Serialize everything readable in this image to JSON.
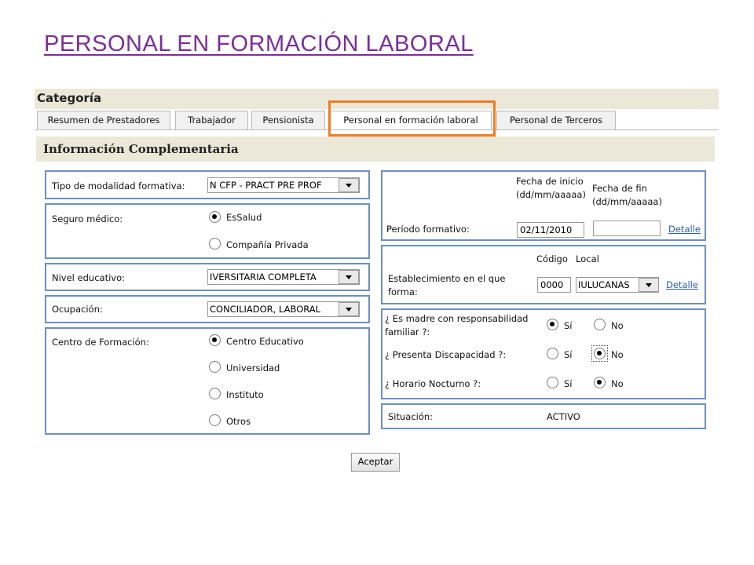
{
  "page_title": "PERSONAL EN FORMACIÓN LABORAL",
  "category": {
    "title": "Categoría",
    "tabs": [
      {
        "label": "Resumen de Prestadores"
      },
      {
        "label": "Trabajador"
      },
      {
        "label": "Pensionista"
      },
      {
        "label": "Personal en formación laboral",
        "active": true
      },
      {
        "label": "Personal de Terceros"
      }
    ]
  },
  "section_title": "Información Complementaria",
  "left": {
    "modalidad": {
      "label": "Tipo de modalidad formativa:",
      "value": "N CFP - PRACT PRE PROF"
    },
    "seguro": {
      "label": "Seguro médico:",
      "options": [
        "EsSalud",
        "Compañía Privada"
      ],
      "selected": "EsSalud"
    },
    "nivel": {
      "label": "Nivel educativo:",
      "value": "IVERSITARIA COMPLETA"
    },
    "ocupacion": {
      "label": "Ocupación:",
      "value": "CONCILIADOR, LABORAL"
    },
    "centro": {
      "label": "Centro de Formación:",
      "options": [
        "Centro Educativo",
        "Universidad",
        "Instituto",
        "Otros"
      ],
      "selected": "Centro Educativo"
    }
  },
  "right": {
    "periodo": {
      "label": "Período formativo:",
      "inicio_header": "Fecha de inicio (dd/mm/aaaaa)",
      "fin_header": "Fecha de fin (dd/mm/aaaaa)",
      "inicio_value": "02/11/2010",
      "fin_value": "",
      "detalle": "Detalle"
    },
    "establecimiento": {
      "label": "Establecimiento en el que forma:",
      "codigo_header": "Código",
      "local_header": "Local",
      "codigo_value": "0000",
      "local_value": "IULUCANAS",
      "detalle": "Detalle"
    },
    "questions": {
      "madre": {
        "label": "¿ Es madre con responsabilidad familiar ?:",
        "si": "Sí",
        "no": "No",
        "selected": "Sí"
      },
      "discapacidad": {
        "label": "¿ Presenta Discapacidad ?:",
        "si": "Sí",
        "no": "No",
        "selected": "No"
      },
      "nocturno": {
        "label": "¿ Horario Nocturno ?:",
        "si": "Sí",
        "no": "No",
        "selected": "No"
      }
    },
    "situacion": {
      "label": "Situación:",
      "value": "ACTIVO"
    }
  },
  "accept_button": "Aceptar",
  "colors": {
    "title": "#7a2e9a",
    "highlight": "#ef7d22",
    "box_border": "#6c8fc4",
    "link": "#2b5fb8",
    "bar": "#ebe8d8"
  }
}
